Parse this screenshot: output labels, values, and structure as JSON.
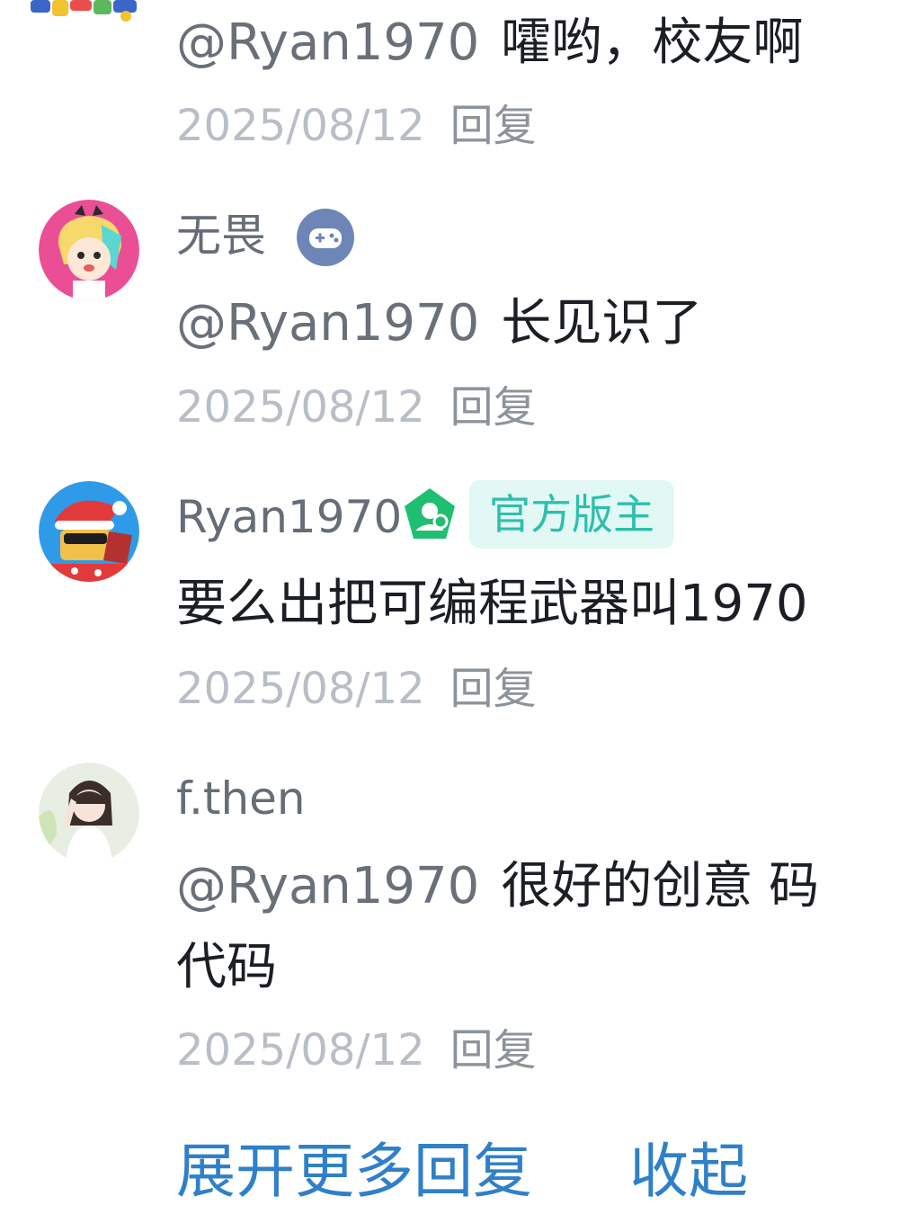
{
  "replies": [
    {
      "mention": "@Ryan1970",
      "content": "嚯哟，校友啊",
      "date": "2025/08/12",
      "reply_label": "回复"
    },
    {
      "username": "无畏",
      "badge_icon": "gamepad-icon",
      "mention": "@Ryan1970",
      "content": "长见识了",
      "date": "2025/08/12",
      "reply_label": "回复"
    },
    {
      "username": "Ryan1970",
      "badge_icon": "official-moderator-icon",
      "role_tag": "官方版主",
      "content": "要么出把可编程武器叫1970",
      "date": "2025/08/12",
      "reply_label": "回复"
    },
    {
      "username": "f.then",
      "mention": "@Ryan1970",
      "content_line1": "很好的创意 码",
      "content_line2": "代码",
      "date": "2025/08/12",
      "reply_label": "回复"
    }
  ],
  "footer": {
    "expand_label": "展开更多回复",
    "collapse_label": "收起"
  },
  "colors": {
    "link_blue": "#2f80c8",
    "role_tag_bg": "#e1f8f4",
    "role_tag_text": "#2dbfab",
    "moderator_green": "#1fbf72",
    "game_badge": "#6d86b7"
  }
}
